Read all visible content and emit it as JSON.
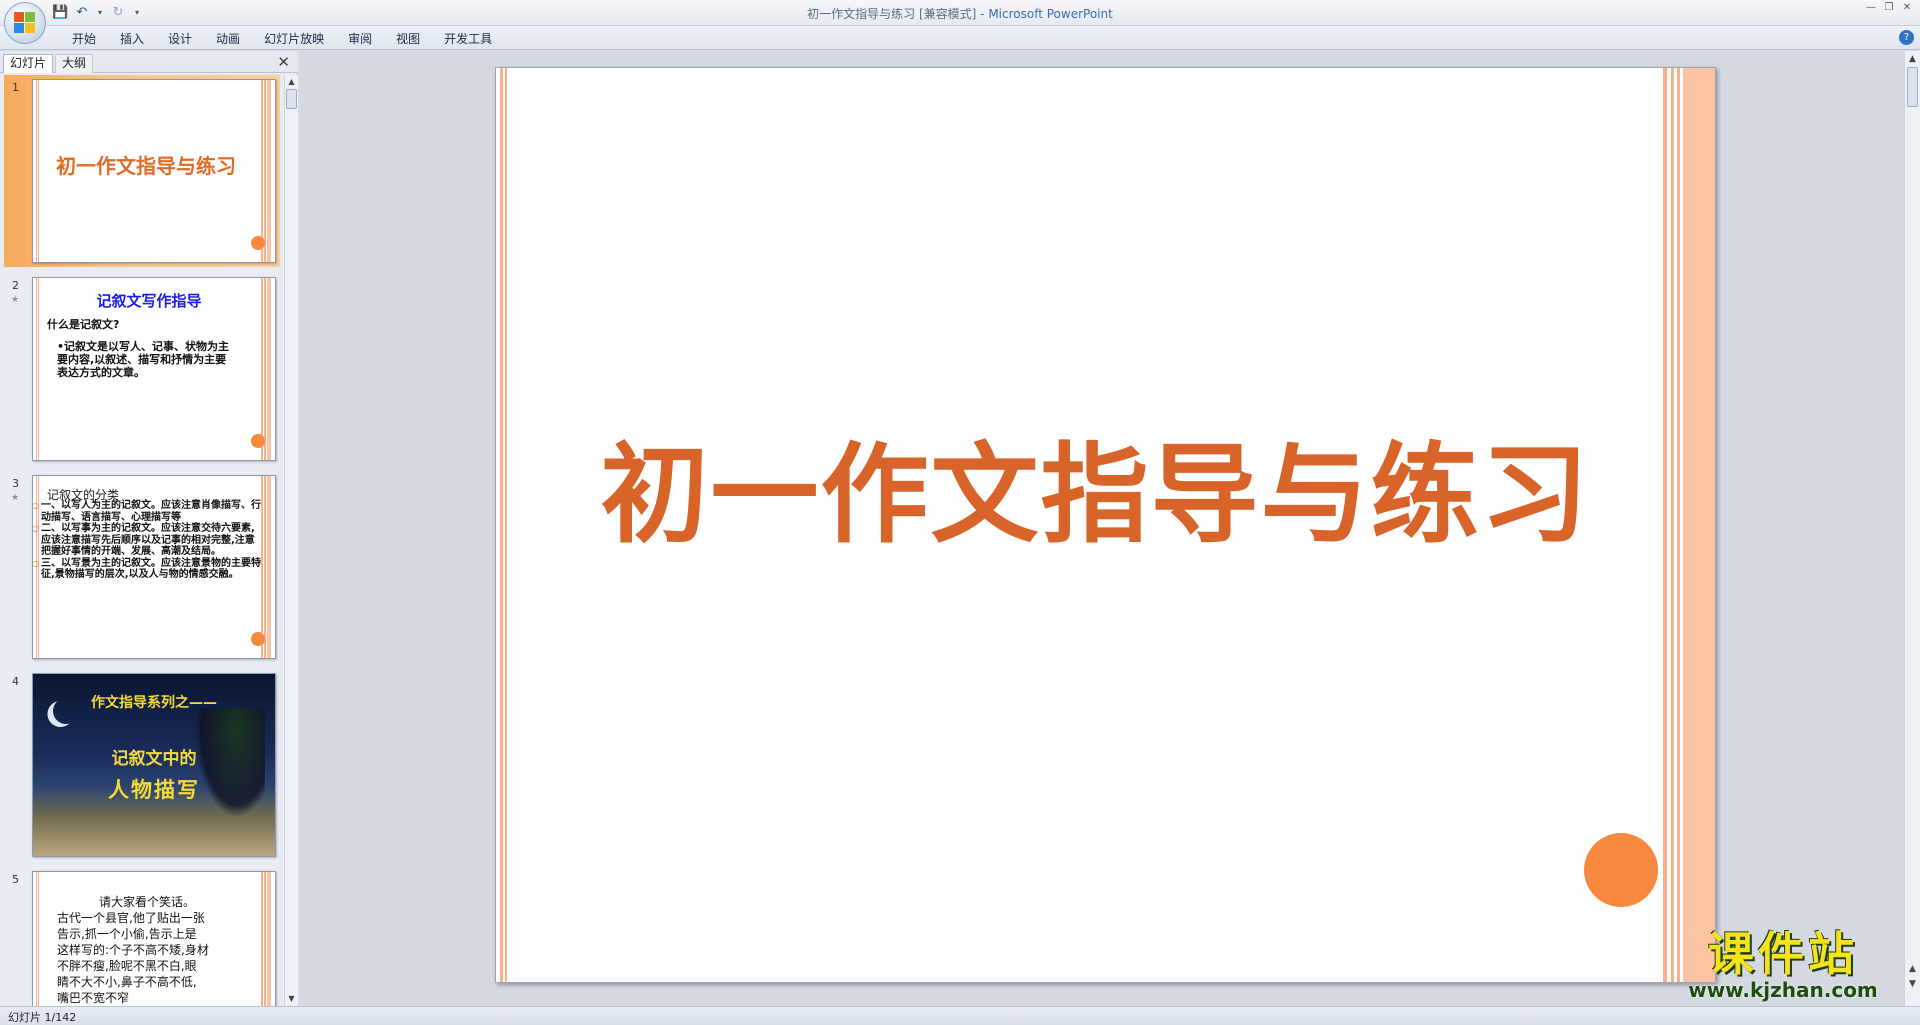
{
  "window": {
    "title": "初一作文指导与练习 [兼容模式] - ",
    "app_name": "Microsoft PowerPoint"
  },
  "ribbon": {
    "tabs": [
      "开始",
      "插入",
      "设计",
      "动画",
      "幻灯片放映",
      "审阅",
      "视图",
      "开发工具"
    ]
  },
  "left_pane": {
    "tabs": [
      "幻灯片",
      "大纲"
    ],
    "close": "✕"
  },
  "thumbnails": [
    {
      "num": "1",
      "title": "初一作文指导与练习"
    },
    {
      "num": "2",
      "title": "记叙文写作指导",
      "subtitle": "什么是记叙文?",
      "body": "•记叙文是以写人、记事、状物为主要内容,以叙述、描写和抒情为主要表达方式的文章。"
    },
    {
      "num": "3",
      "title": "记叙文的分类",
      "items": [
        "一、以写人为主的记叙文。应该注意肖像描写、行动描写、语言描写、心理描写等",
        "二、以写事为主的记叙文。应该注意交待六要素,应该注意描写先后顺序以及记事的相对完整,注意把握好事情的开端、发展、高潮及结局。",
        "三、以写景为主的记叙文。应该注意景物的主要特征,景物描写的层次,以及人与物的情感交融。"
      ]
    },
    {
      "num": "4",
      "line1": "作文指导系列之——",
      "line2": "记叙文中的",
      "line3": "人物描写"
    },
    {
      "num": "5",
      "lines": [
        "请大家看个笑话。",
        "古代一个县官,他了贴出一张",
        "告示,抓一个小偷,告示上是",
        "这样写的:个子不高不矮,身材",
        "不胖不瘦,脸呢不黑不白,眼",
        "睛不大不小,鼻子不高不低,",
        "嘴巴不宽不窄"
      ]
    }
  ],
  "slide": {
    "title": "初一作文指导与练习"
  },
  "watermark": {
    "name": "课件站",
    "url": "www.kjzhan.com"
  },
  "status": {
    "text": "幻灯片 1/142"
  },
  "colors": {
    "accent_orange": "#d8642a",
    "dot_orange": "#f7893f",
    "stripe": "#fbb08a"
  }
}
